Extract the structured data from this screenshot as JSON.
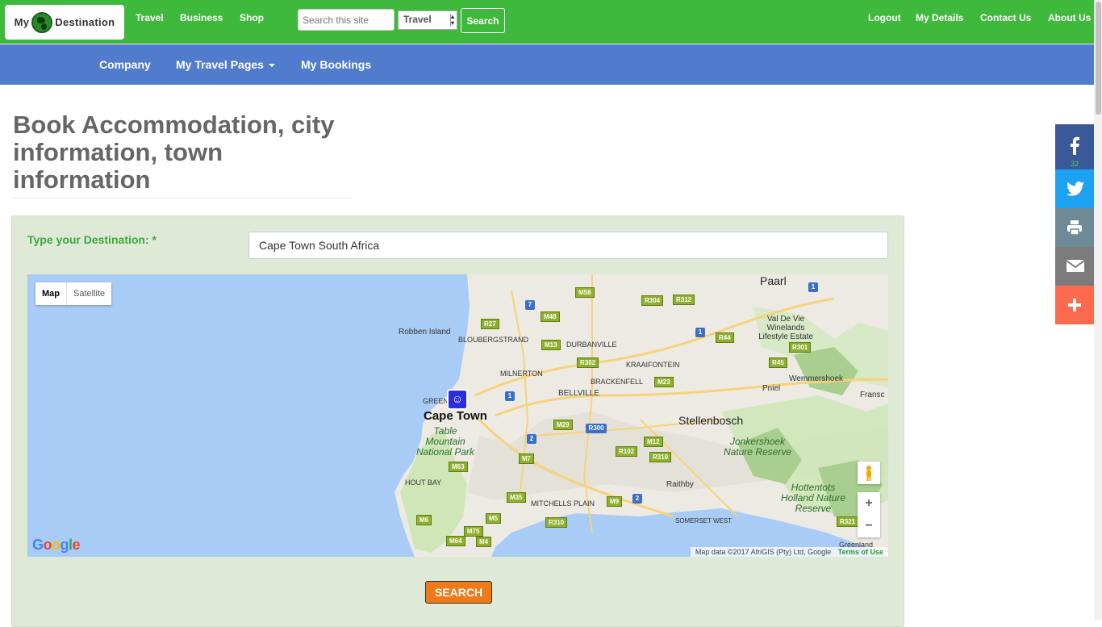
{
  "topbar": {
    "logo_text_left": "My",
    "logo_text_right": "Destination",
    "links": [
      "Travel",
      "Business",
      "Shop"
    ],
    "search_placeholder": "Search this site",
    "category_value": "Travel",
    "search_button": "Search",
    "right_links": [
      "Logout",
      "My Details",
      "Contact Us",
      "About Us"
    ]
  },
  "navbar": {
    "items": [
      "Company",
      "My Travel Pages",
      "My Bookings"
    ]
  },
  "page": {
    "title": "Book Accommodation, city information, town information"
  },
  "form": {
    "destination_label": "Type your Destination: *",
    "destination_value": "Cape Town South Africa",
    "submit_label": "SEARCH"
  },
  "map": {
    "map_type_options": [
      "Map",
      "Satellite"
    ],
    "selected_map_type": "Map",
    "zoom_in": "+",
    "zoom_out": "−",
    "attribution": "Map data ©2017 AfriGIS (Pty) Ltd, Google",
    "terms": "Terms of Use",
    "logo": "Google",
    "labels": {
      "paarl": "Paarl",
      "robben_island": "Robben Island",
      "bloubergstrand": "BLOUBERGSTRAND",
      "durbanville": "DURBANVILLE",
      "kraaifontein": "KRAAIFONTEIN",
      "milnerton": "MILNERTON",
      "brackenfell": "BRACKENFELL",
      "bellville": "BELLVILLE",
      "green_point": "GREEN",
      "cape_town": "Cape Town",
      "table_mountain": "Table Mountain National Park",
      "stellenbosch": "Stellenbosch",
      "jonkershoek": "Jonkershoek Nature Reserve",
      "val_de_vie": "Val De Vie Winelands Lifestyle Estate",
      "wemmershoek": "Wemmershoek",
      "pniel": "Pniel",
      "fransc": "Fransc",
      "hout_bay": "HOUT BAY",
      "raithby": "Raithby",
      "mitchells_plain": "MITCHELLS PLAIN",
      "somerset_west": "SOMERSET WEST",
      "hottentots": "Hottentots Holland Nature Reserve",
      "greenland": "Greenland"
    },
    "route_badges": [
      "M58",
      "R304",
      "R312",
      "R27",
      "M48",
      "M13",
      "R44",
      "R301",
      "R302",
      "M23",
      "R45",
      "M29",
      "R300",
      "M12",
      "R102",
      "R310",
      "M7",
      "M63",
      "M35",
      "M9",
      "M5",
      "R310",
      "M6",
      "M75",
      "M64",
      "M4",
      "R321"
    ],
    "national_badges": [
      "7",
      "1",
      "1",
      "1",
      "2",
      "2",
      "1"
    ]
  },
  "share": {
    "facebook_count": "32",
    "buttons": [
      "facebook",
      "twitter",
      "print",
      "email",
      "more"
    ],
    "colors": {
      "facebook": "#3b5998",
      "twitter": "#1da1f2",
      "print": "#6d8a96",
      "email": "#7b7b7b",
      "more": "#fd6a4e"
    }
  },
  "colors": {
    "topbar": "#3eb93c",
    "navbar": "#517ccd",
    "panel": "#dee9d6",
    "accent_orange": "#f07a17"
  }
}
